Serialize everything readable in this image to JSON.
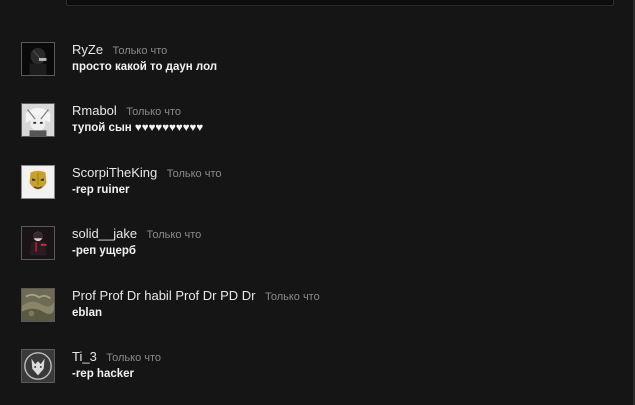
{
  "comments": [
    {
      "author": "RyZe",
      "time": "Только что",
      "text": "просто какой то даун лол",
      "avatar_icon": "dark-figure-avatar-icon"
    },
    {
      "author": "Rmabol",
      "time": "Только что",
      "text": "тупой сын ♥♥♥♥♥♥♥♥♥♥",
      "avatar_icon": "anime-character-avatar-icon"
    },
    {
      "author": "ScorpiTheKing",
      "time": "Только что",
      "text": "-rep ruiner",
      "avatar_icon": "gold-mask-avatar-icon"
    },
    {
      "author": "solid__jake",
      "time": "Только что",
      "text": "-реп ущерб",
      "avatar_icon": "anime-girl-avatar-icon"
    },
    {
      "author": "Prof Prof Dr habil Prof Dr PD Dr",
      "time": "Только что",
      "text": "eblan",
      "avatar_icon": "landscape-avatar-icon"
    },
    {
      "author": "Ti_3",
      "time": "Только что",
      "text": "-rep hacker",
      "avatar_icon": "wolf-avatar-icon"
    }
  ]
}
